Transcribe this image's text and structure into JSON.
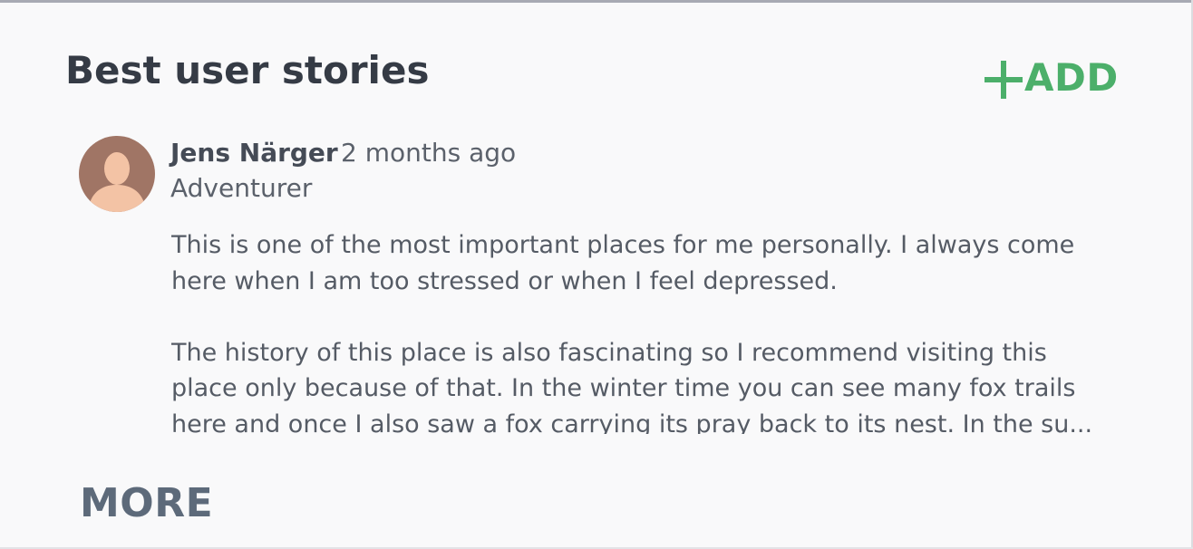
{
  "section": {
    "title": "Best user stories",
    "add_label": "ADD",
    "more_label": "MORE"
  },
  "story": {
    "author_name": "Jens Närger",
    "time_ago": "2 months ago",
    "author_role": "Adventurer",
    "paragraph_1_line_1": "This is one of the most important places for me personally. I always come",
    "paragraph_1_line_2": "here when I am too stressed or when I feel depressed.",
    "paragraph_2_line_1": "The history of this place is also fascinating so I recommend visiting this",
    "paragraph_2_line_2": "place only because of that. In the winter time you can see many fox trails",
    "paragraph_2_line_3": "here and once I also saw a fox carrying its pray back to its nest. In the su..."
  },
  "colors": {
    "accent_add": "#4caf6a",
    "title_text": "#353b45",
    "more_text": "#5d6a7a",
    "avatar_bg": "#a07565",
    "avatar_figure": "#f3c3a5"
  },
  "icons": {
    "add": "plus-icon",
    "avatar": "user-silhouette-icon"
  }
}
